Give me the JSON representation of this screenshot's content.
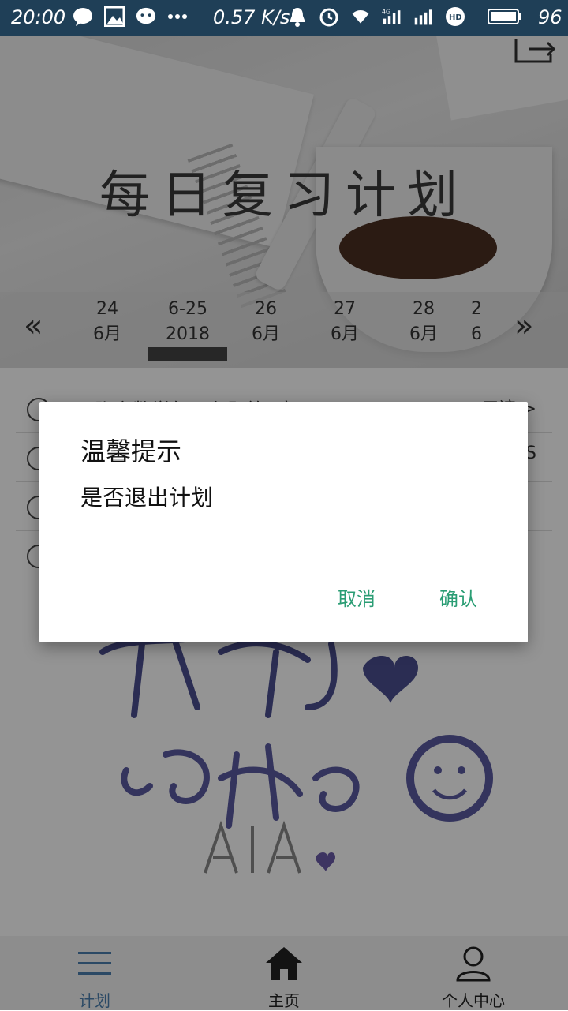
{
  "status_bar": {
    "time": "20:00",
    "net_speed": "0.57 K/s",
    "battery": "96",
    "icons": [
      "chat-bubble-icon",
      "image-icon",
      "wechat-icon",
      "more-dots-icon",
      "bell-icon",
      "alarm-icon",
      "wifi-icon",
      "4g-signal-icon",
      "signal-icon",
      "hd-icon",
      "battery-icon"
    ]
  },
  "header": {
    "title": "每日复习计划",
    "export_icon": "exit-icon"
  },
  "date_bar": {
    "prev_icon": "«",
    "next_icon": "»",
    "dates": [
      {
        "top": "24",
        "bottom": "6月"
      },
      {
        "top": "6-25",
        "bottom": "2018"
      },
      {
        "top": "26",
        "bottom": "6月"
      },
      {
        "top": "27",
        "bottom": "6月"
      },
      {
        "top": "28",
        "bottom": "6月"
      },
      {
        "top": "2",
        "bottom": "6"
      }
    ]
  },
  "plan_list": {
    "rows": [
      {
        "text": "张宇数学每日九题第1章",
        "right": "五遍 >"
      },
      {
        "text": "",
        "right": "S"
      },
      {
        "text": "",
        "right": ""
      },
      {
        "text": "",
        "right": ""
      }
    ]
  },
  "dialog": {
    "title": "温馨提示",
    "message": "是否退出计划",
    "cancel_label": "取消",
    "confirm_label": "确认",
    "accent_color": "#2a9d74"
  },
  "tab_bar": {
    "tabs": [
      {
        "label": "计划",
        "icon": "list-icon"
      },
      {
        "label": "主页",
        "icon": "home-icon"
      },
      {
        "label": "个人中心",
        "icon": "person-icon"
      }
    ],
    "active_color": "#4a7fae"
  }
}
